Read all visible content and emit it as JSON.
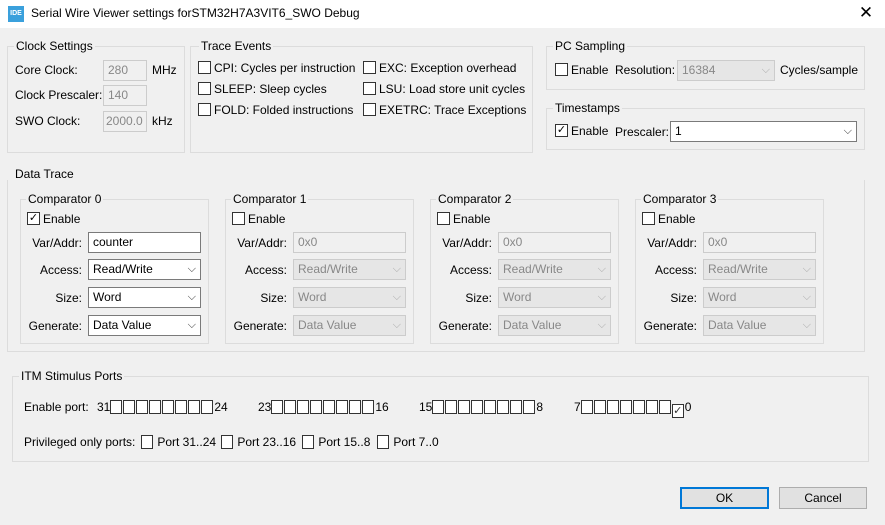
{
  "window": {
    "icon_text": "IDE",
    "title": "Serial Wire Viewer settings forSTM32H7A3VIT6_SWO Debug",
    "close": "✕"
  },
  "clock": {
    "title": "Clock Settings",
    "core_label": "Core Clock:",
    "core_value": "280",
    "core_unit": "MHz",
    "prescaler_label": "Clock Prescaler:",
    "prescaler_value": "140",
    "swo_label": "SWO Clock:",
    "swo_value": "2000.0",
    "swo_unit": "kHz"
  },
  "trace": {
    "title": "Trace Events",
    "items": [
      {
        "label": "CPI: Cycles per instruction",
        "checked": false
      },
      {
        "label": "SLEEP: Sleep cycles",
        "checked": false
      },
      {
        "label": "FOLD: Folded instructions",
        "checked": false
      },
      {
        "label": "EXC: Exception overhead",
        "checked": false
      },
      {
        "label": "LSU: Load store unit cycles",
        "checked": false
      },
      {
        "label": "EXETRC: Trace Exceptions",
        "checked": false
      }
    ]
  },
  "pc": {
    "title": "PC Sampling",
    "enable": "Enable",
    "enabled": false,
    "resolution_label": "Resolution:",
    "resolution": "16384",
    "unit": "Cycles/sample"
  },
  "ts": {
    "title": "Timestamps",
    "enable": "Enable",
    "enabled": true,
    "prescaler_label": "Prescaler:",
    "prescaler": "1"
  },
  "datatrace": {
    "title": "Data Trace",
    "labels": {
      "enable": "Enable",
      "var": "Var/Addr:",
      "access": "Access:",
      "size": "Size:",
      "generate": "Generate:"
    },
    "comparators": [
      {
        "title": "Comparator 0",
        "enabled": true,
        "var": "counter",
        "access": "Read/Write",
        "size": "Word",
        "generate": "Data Value"
      },
      {
        "title": "Comparator 1",
        "enabled": false,
        "var": "0x0",
        "access": "Read/Write",
        "size": "Word",
        "generate": "Data Value"
      },
      {
        "title": "Comparator 2",
        "enabled": false,
        "var": "0x0",
        "access": "Read/Write",
        "size": "Word",
        "generate": "Data Value"
      },
      {
        "title": "Comparator 3",
        "enabled": false,
        "var": "0x0",
        "access": "Read/Write",
        "size": "Word",
        "generate": "Data Value"
      }
    ]
  },
  "itm": {
    "title": "ITM Stimulus Ports",
    "enable_label": "Enable port:",
    "port_groups": [
      {
        "hi": "31",
        "lo": "24"
      },
      {
        "hi": "23",
        "lo": "16"
      },
      {
        "hi": "15",
        "lo": "8"
      },
      {
        "hi": "7",
        "lo": "0"
      }
    ],
    "enabled_ports": [
      0
    ],
    "priv_label": "Privileged only ports:",
    "priv": [
      {
        "label": "Port 31..24",
        "checked": false
      },
      {
        "label": "Port 23..16",
        "checked": false
      },
      {
        "label": "Port 15..8",
        "checked": false
      },
      {
        "label": "Port 7..0",
        "checked": false
      }
    ]
  },
  "buttons": {
    "ok": "OK",
    "cancel": "Cancel"
  }
}
